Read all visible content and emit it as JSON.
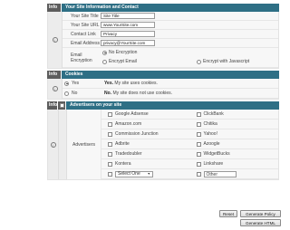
{
  "contact_section": {
    "header_info": "Info",
    "header_title": "Your Site Information and Contact",
    "fields": [
      {
        "label": "Your Site Title",
        "value": "Site Title"
      },
      {
        "label": "Your Site URL",
        "value": "www.YourSite.com"
      },
      {
        "label": "Contact Link",
        "value": "Privacy"
      },
      {
        "label": "Email Address",
        "value": "privacy@YourSite.com"
      }
    ],
    "encryption": {
      "label": "Email Encryption",
      "options": [
        "No Encryption",
        "Encrypt Email",
        "Encrypt with Javascript"
      ],
      "selected": "No Encryption"
    }
  },
  "cookies_section": {
    "header_info": "Info",
    "header_title": "Cookies",
    "options": [
      {
        "label": "Yes",
        "bold": "Yes.",
        "text": " My site uses cookies.",
        "selected": true
      },
      {
        "label": "No",
        "bold": "No.",
        "text": " My site does not use cookies.",
        "selected": false
      }
    ]
  },
  "advertisers_section": {
    "header_info": "Info",
    "header_title": "Advertisers on your site",
    "label": "Advertisers",
    "left": [
      "Google Adsense",
      "Amazon.com",
      "Commission Junction",
      "Adbrite",
      "Tradedoubler",
      "Kontera"
    ],
    "right": [
      "ClickBank",
      "Chitika",
      "Yahoo!",
      "Azoogle",
      "WidgetBucks",
      "Linkshare"
    ],
    "select_value": "Select One",
    "other_label": "Other"
  },
  "buttons": {
    "reset": "Reset",
    "generate_policy": "Generate Policy",
    "generate_html": "Generate HTML"
  }
}
